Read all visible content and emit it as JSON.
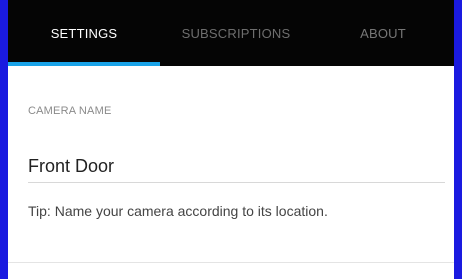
{
  "tabs": {
    "settings": "SETTINGS",
    "subscriptions": "SUBSCRIPTIONS",
    "about": "ABOUT",
    "active": "SETTINGS",
    "accent_color": "#1aa3e8"
  },
  "camera_name": {
    "label": "CAMERA NAME",
    "value": "Front Door",
    "tip": "Tip: Name your camera according to its location."
  },
  "colors": {
    "background": "#1a1ae0",
    "tabbar": "#050505",
    "panel": "#ffffff"
  }
}
